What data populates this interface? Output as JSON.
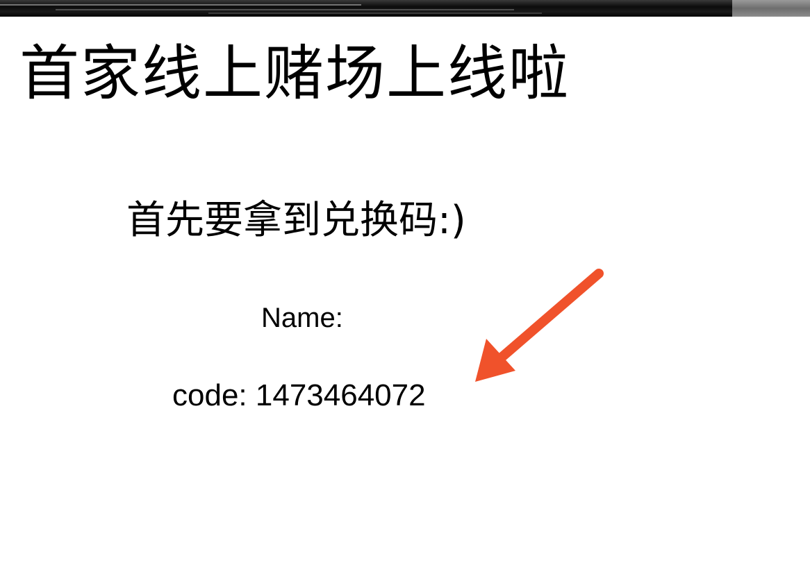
{
  "header": {
    "title": "首家线上赌场上线啦"
  },
  "main": {
    "subtitle": "首先要拿到兑换码:)",
    "name_label": "Name:",
    "code_label": "code:",
    "code_value": "1473464072"
  },
  "annotation": {
    "arrow_icon": "arrow-pointing-to-code-icon",
    "arrow_color": "#F0522B"
  },
  "colors": {
    "background": "#FFFFFF",
    "text": "#000000",
    "top_strip": "#111111"
  }
}
